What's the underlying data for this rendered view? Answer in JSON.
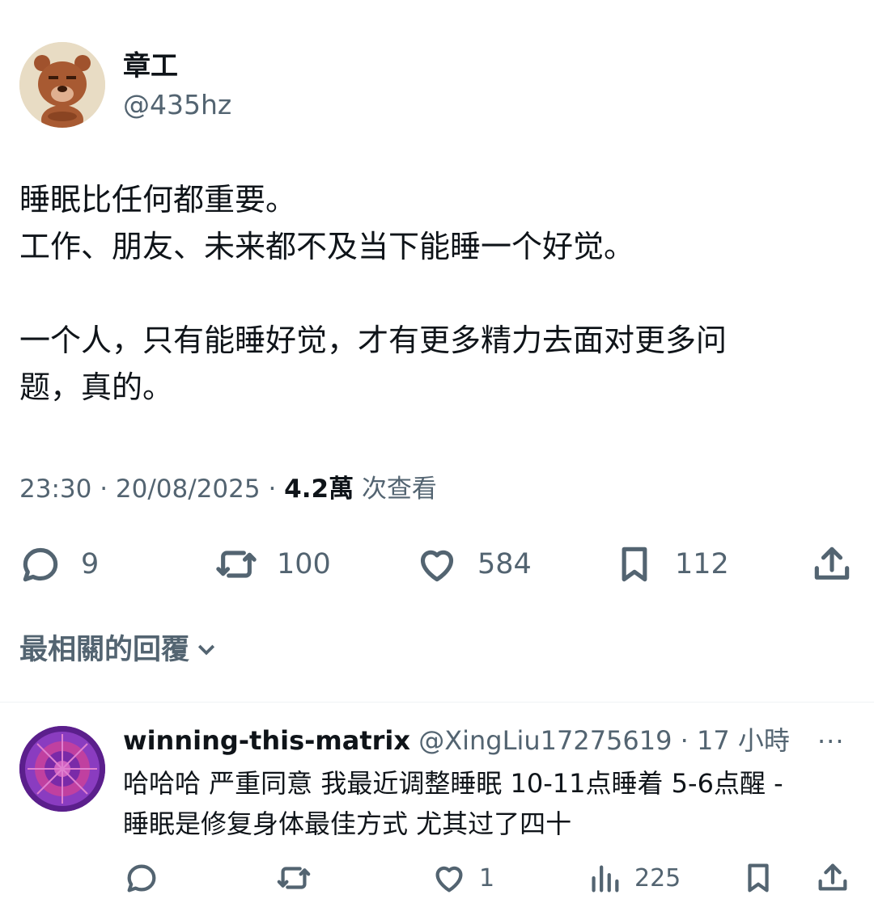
{
  "tweet": {
    "author_name": "章工",
    "author_handle": "@435hz",
    "text_lines": [
      "睡眠比任何都重要。",
      "工作、朋友、未来都不及当下能睡一个好觉。",
      "",
      "一个人，只有能睡好觉，才有更多精力去面对更多问",
      "题，真的。"
    ],
    "time": "23:30",
    "date": "20/08/2025",
    "views_count": "4.2萬",
    "views_label": "次查看",
    "replies": "9",
    "retweets": "100",
    "likes": "584",
    "bookmarks": "112"
  },
  "replies_sort": {
    "label": "最相關的回覆"
  },
  "reply": {
    "author_name": "winning-this-matrix",
    "author_handle": "@XingLiu17275619",
    "time_ago": "17 小時",
    "more": "···",
    "text_lines": [
      "哈哈哈 严重同意 我最近调整睡眠 10-11点睡着 5-6点醒 -",
      "睡眠是修复身体最佳方式 尤其过了四十"
    ],
    "likes": "1",
    "views": "225"
  },
  "icons": {
    "reply": "reply-icon",
    "retweet": "retweet-icon",
    "like": "heart-icon",
    "bookmark": "bookmark-icon",
    "share": "share-icon",
    "views": "views-icon",
    "chevron": "chevron-down-icon",
    "more": "more-icon"
  },
  "colors": {
    "text": "#0f1419",
    "secondary": "#536471",
    "divider": "#eff3f4"
  }
}
